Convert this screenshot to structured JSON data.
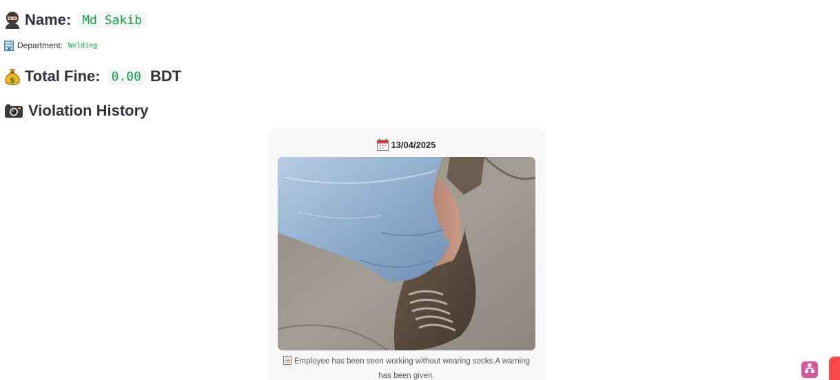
{
  "profile": {
    "name_label": "Name:",
    "name_value": "Md Sakib",
    "name_icon": "ninja-icon",
    "department_label": "Department:",
    "department_value": "Welding",
    "department_icon": "office-building-icon"
  },
  "fine": {
    "label": "Total Fine:",
    "value": "0.00",
    "unit": "BDT",
    "icon": "money-bag-icon"
  },
  "history": {
    "heading": "Violation History",
    "icon": "camera-icon",
    "violations": [
      {
        "date": "13/04/2025",
        "date_icon": "calendar-icon",
        "note_icon": "memo-icon",
        "note": "Employee has been seen working without wearing socks.A warning has been given."
      }
    ]
  },
  "colors": {
    "code_text": "#09ab3b",
    "code_bg": "#f6f7f9",
    "card_bg": "#f9f9f9",
    "widget_pink": "#d9569b",
    "widget_red": "#ff4b4b"
  }
}
